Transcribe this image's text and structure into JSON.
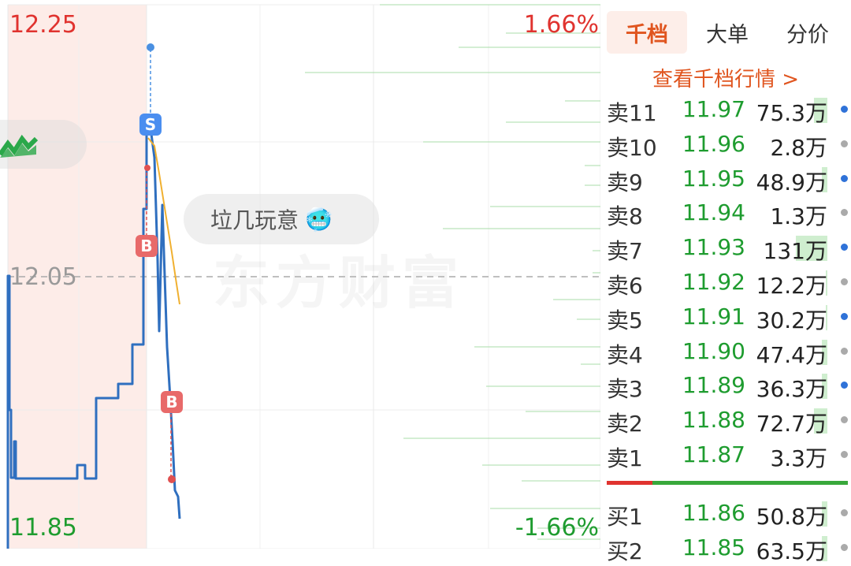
{
  "chart": {
    "price_high": "12.25",
    "price_mid": "12.05",
    "price_low": "11.85",
    "pct_high": "1.66%",
    "pct_low": "-1.66%",
    "markers": {
      "sell": "S",
      "buy_1": "B",
      "buy_2": "B"
    },
    "gift_text": "垃几玩意",
    "gift_emoji": "🥶",
    "watermark": "东方财富",
    "colors": {
      "up": "#e0332f",
      "down": "#1e9c2f",
      "line": "#2f6fbf",
      "avg": "#f0b030"
    }
  },
  "panel": {
    "tabs": [
      "千档",
      "大单",
      "分价"
    ],
    "active_tab": 0,
    "view_link": "查看千档行情 >",
    "asks": [
      {
        "label": "卖11",
        "price": "11.97",
        "volume": "75.3万",
        "bar": 0.14,
        "dot": "blue"
      },
      {
        "label": "卖10",
        "price": "11.96",
        "volume": "2.8万",
        "bar": 0.0,
        "dot": "gray"
      },
      {
        "label": "卖9",
        "price": "11.95",
        "volume": "48.9万",
        "bar": 0.06,
        "dot": "blue"
      },
      {
        "label": "卖8",
        "price": "11.94",
        "volume": "1.3万",
        "bar": 0.0,
        "dot": "gray"
      },
      {
        "label": "卖7",
        "price": "11.93",
        "volume": "131万",
        "bar": 0.33,
        "dot": "blue"
      },
      {
        "label": "卖6",
        "price": "11.92",
        "volume": "12.2万",
        "bar": 0.02,
        "dot": "gray"
      },
      {
        "label": "卖5",
        "price": "11.91",
        "volume": "30.2万",
        "bar": 0.02,
        "dot": "blue"
      },
      {
        "label": "卖4",
        "price": "11.90",
        "volume": "47.4万",
        "bar": 0.06,
        "dot": "gray"
      },
      {
        "label": "卖3",
        "price": "11.89",
        "volume": "36.3万",
        "bar": 0.06,
        "dot": "blue"
      },
      {
        "label": "卖2",
        "price": "11.88",
        "volume": "72.7万",
        "bar": 0.14,
        "dot": "gray"
      },
      {
        "label": "卖1",
        "price": "11.87",
        "volume": "3.3万",
        "bar": 0.0,
        "dot": "gray"
      }
    ],
    "bids": [
      {
        "label": "买1",
        "price": "11.86",
        "volume": "50.8万",
        "bar": 0.06,
        "dot": "gray"
      },
      {
        "label": "买2",
        "price": "11.85",
        "volume": "63.5万",
        "bar": 0.06,
        "dot": "gray"
      }
    ]
  }
}
